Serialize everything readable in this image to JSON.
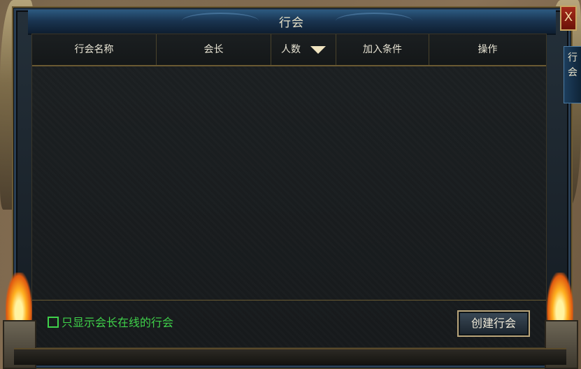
{
  "window": {
    "title": "行会",
    "close_label": "X"
  },
  "side_tab": {
    "label": "行会"
  },
  "table": {
    "columns": [
      "行会名称",
      "会长",
      "人数",
      "加入条件",
      "操作"
    ],
    "rows": []
  },
  "filter": {
    "label": "只显示会长在线的行会",
    "checked": false
  },
  "actions": {
    "create_label": "创建行会"
  },
  "colors": {
    "accent_green": "#3fd14a",
    "frame_blue": "#2c5a80",
    "gold_border": "#b9a57a"
  }
}
